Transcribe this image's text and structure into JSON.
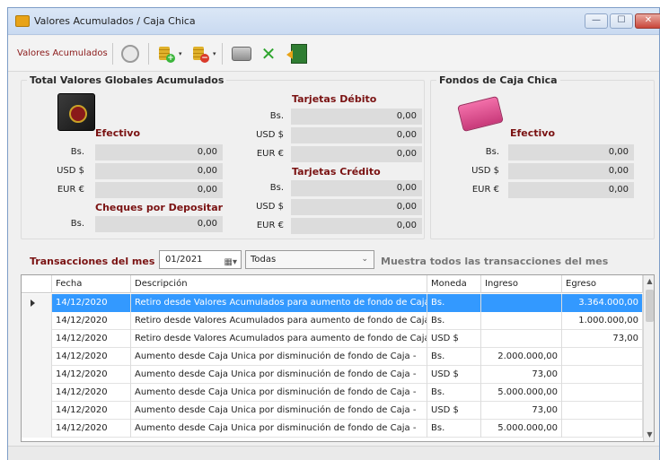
{
  "window": {
    "title": "Valores Acumulados / Caja Chica",
    "min_glyph": "—",
    "max_glyph": "☐",
    "close_glyph": "✕"
  },
  "toolbar": {
    "label": "Valores Acumulados",
    "icons": [
      "refresh-icon",
      "coins-add-icon",
      "coins-remove-icon",
      "print-icon",
      "shuffle-icon",
      "exit-icon"
    ],
    "dropdown_arrow": "▾"
  },
  "totals": {
    "title": "Total Valores Globales Acumulados",
    "efectivo": {
      "title": "Efectivo",
      "rows": [
        {
          "currency": "Bs.",
          "value": "0,00"
        },
        {
          "currency": "USD $",
          "value": "0,00"
        },
        {
          "currency": "EUR €",
          "value": "0,00"
        }
      ]
    },
    "cheques": {
      "title": "Cheques por Depositar",
      "rows": [
        {
          "currency": "Bs.",
          "value": "0,00"
        }
      ]
    },
    "debito": {
      "title": "Tarjetas Débito",
      "rows": [
        {
          "currency": "Bs.",
          "value": "0,00"
        },
        {
          "currency": "USD $",
          "value": "0,00"
        },
        {
          "currency": "EUR €",
          "value": "0,00"
        }
      ]
    },
    "credito": {
      "title": "Tarjetas Crédito",
      "rows": [
        {
          "currency": "Bs.",
          "value": "0,00"
        },
        {
          "currency": "USD $",
          "value": "0,00"
        },
        {
          "currency": "EUR €",
          "value": "0,00"
        }
      ]
    }
  },
  "fondos": {
    "title": "Fondos de Caja Chica",
    "efectivo": {
      "title": "Efectivo",
      "rows": [
        {
          "currency": "Bs.",
          "value": "0,00"
        },
        {
          "currency": "USD $",
          "value": "0,00"
        },
        {
          "currency": "EUR €",
          "value": "0,00"
        }
      ]
    }
  },
  "transactions": {
    "label": "Transacciones del mes",
    "month_value": "01/2021",
    "calendar_glyph": "▦▾",
    "filter_value": "Todas",
    "filter_chevron": "⌄",
    "hint": "Muestra todos las transacciones del mes",
    "columns": [
      "Fecha",
      "Descripción",
      "Moneda",
      "Ingreso",
      "Egreso"
    ],
    "rows": [
      {
        "fecha": "14/12/2020",
        "descripcion": "Retiro desde Valores Acumulados para aumento de fondo de Caja -",
        "moneda": "Bs.",
        "ingreso": "",
        "egreso": "3.364.000,00",
        "selected": true
      },
      {
        "fecha": "14/12/2020",
        "descripcion": "Retiro desde Valores Acumulados para aumento de fondo de Caja -",
        "moneda": "Bs.",
        "ingreso": "",
        "egreso": "1.000.000,00"
      },
      {
        "fecha": "14/12/2020",
        "descripcion": "Retiro desde Valores Acumulados para aumento de fondo de Caja -",
        "moneda": "USD $",
        "ingreso": "",
        "egreso": "73,00"
      },
      {
        "fecha": "14/12/2020",
        "descripcion": "Aumento desde Caja Unica por disminución de fondo de Caja -",
        "moneda": "Bs.",
        "ingreso": "2.000.000,00",
        "egreso": ""
      },
      {
        "fecha": "14/12/2020",
        "descripcion": "Aumento desde Caja Unica por disminución de fondo de Caja -",
        "moneda": "USD $",
        "ingreso": "73,00",
        "egreso": ""
      },
      {
        "fecha": "14/12/2020",
        "descripcion": "Aumento desde Caja Unica por disminución de fondo de Caja -",
        "moneda": "Bs.",
        "ingreso": "5.000.000,00",
        "egreso": ""
      },
      {
        "fecha": "14/12/2020",
        "descripcion": "Aumento desde Caja Unica por disminución de fondo de Caja -",
        "moneda": "USD $",
        "ingreso": "73,00",
        "egreso": ""
      },
      {
        "fecha": "14/12/2020",
        "descripcion": "Aumento desde Caja Unica por disminución de fondo de Caja -",
        "moneda": "Bs.",
        "ingreso": "5.000.000,00",
        "egreso": ""
      }
    ],
    "scroll_up": "▲",
    "scroll_down": "▼"
  }
}
